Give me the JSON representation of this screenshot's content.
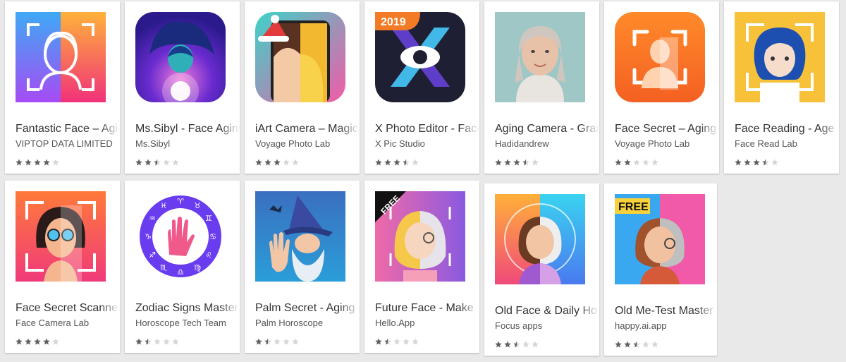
{
  "apps": [
    {
      "title": "Fantastic Face – Aging",
      "developer": "VIPTOP DATA LIMITED",
      "rating": 4,
      "icon": "fantastic-face-icon"
    },
    {
      "title": "Ms.Sibyl - Face Aging",
      "developer": "Ms.Sibyl",
      "rating": 2.5,
      "icon": "ms-sibyl-icon"
    },
    {
      "title": "iArt Camera – Magic",
      "developer": "Voyage Photo Lab",
      "rating": 3,
      "icon": "iart-camera-icon"
    },
    {
      "title": "X Photo Editor - Face",
      "developer": "X Pic Studio",
      "rating": 3.5,
      "icon": "x-photo-editor-icon",
      "badge": "2019"
    },
    {
      "title": "Aging Camera - Gram",
      "developer": "Hadidandrew",
      "rating": 3.5,
      "icon": "aging-camera-icon"
    },
    {
      "title": "Face Secret – Aging",
      "developer": "Voyage Photo Lab",
      "rating": 2,
      "icon": "face-secret-icon"
    },
    {
      "title": "Face Reading - Age",
      "developer": "Face Read Lab",
      "rating": 3.5,
      "icon": "face-reading-icon"
    },
    {
      "title": "Face Secret Scanner",
      "developer": "Face Camera Lab",
      "rating": 4,
      "icon": "face-secret-scanner-icon"
    },
    {
      "title": "Zodiac Signs Master",
      "developer": "Horoscope Tech Team",
      "rating": 1.5,
      "icon": "zodiac-signs-icon"
    },
    {
      "title": "Palm Secret - Aging",
      "developer": "Palm Horoscope",
      "rating": 1.5,
      "icon": "palm-secret-icon"
    },
    {
      "title": "Future Face - Make",
      "developer": "Hello.App",
      "rating": 1.5,
      "icon": "future-face-icon",
      "badge": "FREE"
    },
    {
      "title": "Old Face & Daily Ho",
      "developer": "Focus apps",
      "rating": 2.5,
      "icon": "old-face-icon"
    },
    {
      "title": "Old Me-Test Master",
      "developer": "happy.ai.app",
      "rating": 2.5,
      "icon": "old-me-icon",
      "badge": "FREE"
    }
  ],
  "colors": {
    "star_filled": "#616161",
    "star_empty": "#d6d6d6",
    "background": "#e9e9e9"
  }
}
